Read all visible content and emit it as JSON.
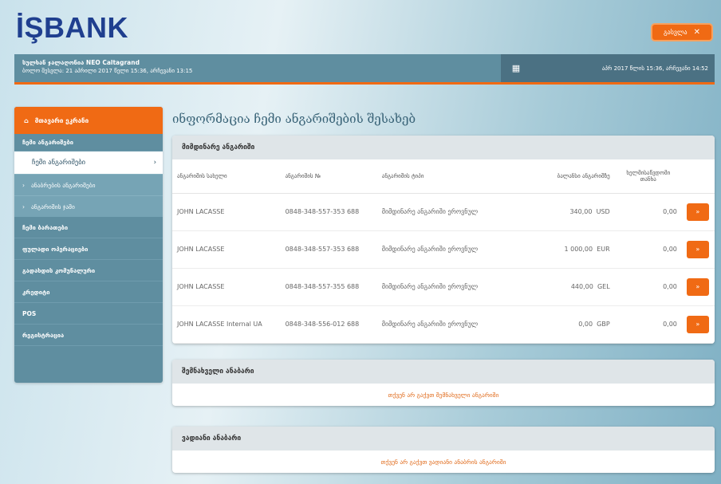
{
  "brand": {
    "logo": "İŞBANK"
  },
  "header": {
    "logout_label": "გასვლა",
    "close_glyph": "✕"
  },
  "infobar": {
    "name": "სულხან ჯალაღონია NEO Caltagrand",
    "last_login": "ბოლო შესვლა: 21 აპრილი 2017 წელი 15:36, არჩევანი 13:15",
    "date": "აპრ 2017 წლის 15:36, არჩევანი 14:52"
  },
  "sidebar": {
    "head": "მთავარი ეკრანი",
    "group": "ჩემი ანგარიშები",
    "active": "ჩემი ანგარიშები",
    "subs": [
      "ანაბრების ანგარიშები",
      "ანგარიშის ჯამი"
    ],
    "items": [
      "ჩემი ბარათები",
      "ფულადი ოპერაციები",
      "გადახდის კომუნალური",
      "კრედიტი",
      "POS",
      "რეგისტრაცია"
    ]
  },
  "main": {
    "title": "ინფორმაცია ჩემი ანგარიშების შესახებ",
    "accounts": {
      "heading": "მიმდინარე ანგარიში",
      "columns": [
        "ანგარიშის სახელი",
        "ანგარიშის №",
        "ანგარიშის ტიპი",
        "ბალანსი ანგარიშზე",
        "ხელმისაწვდომი თანხა"
      ],
      "rows": [
        {
          "name": "JOHN LACASSE",
          "number": "0848-348-557-353 688",
          "type": "მიმდინარე ანგარიში ეროვნულ",
          "balance": "340,00",
          "currency": "USD",
          "available": "0,00",
          "btn": "»"
        },
        {
          "name": "JOHN LACASSE",
          "number": "0848-348-557-353 688",
          "type": "მიმდინარე ანგარიში ეროვნულ",
          "balance": "1 000,00",
          "currency": "EUR",
          "available": "0,00",
          "btn": "»"
        },
        {
          "name": "JOHN LACASSE",
          "number": "0848-348-557-355 688",
          "type": "მიმდინარე ანგარიში ეროვნულ",
          "balance": "440,00",
          "currency": "GEL",
          "available": "0,00",
          "btn": "»"
        },
        {
          "name": "JOHN LACASSE Internal UA",
          "number": "0848-348-556-012 688",
          "type": "მიმდინარე ანგარიში ეროვნულ",
          "balance": "0,00",
          "currency": "GBP",
          "available": "0,00",
          "btn": "»"
        }
      ]
    },
    "deposits": {
      "heading": "შემნახველი ანაბარი",
      "empty": "თქვენ არ გაქვთ შემნახველი ანგარიში"
    },
    "loans": {
      "heading": "ვადიანი ანაბარი",
      "empty": "თქვენ არ გაქვთ ვადიანი ანაბრის ანგარიში"
    }
  }
}
